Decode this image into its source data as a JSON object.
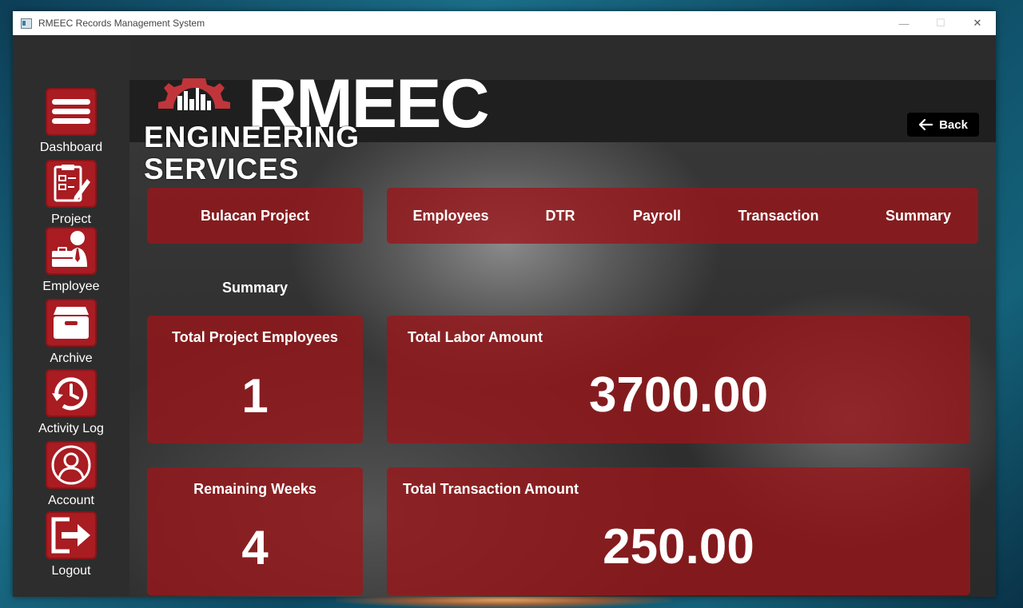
{
  "window": {
    "title": "RMEEC Records Management System",
    "controls": {
      "minimize": "—",
      "maximize": "☐",
      "close": "✕"
    }
  },
  "sidebar": {
    "items": [
      {
        "label": "Dashboard",
        "icon": "menu-icon"
      },
      {
        "label": "Project",
        "icon": "clipboard-edit-icon"
      },
      {
        "label": "Employee",
        "icon": "employee-briefcase-icon"
      },
      {
        "label": "Archive",
        "icon": "archive-box-icon"
      },
      {
        "label": "Activity Log",
        "icon": "history-clock-icon"
      },
      {
        "label": "Account",
        "icon": "user-circle-icon"
      },
      {
        "label": "Logout",
        "icon": "logout-icon"
      }
    ]
  },
  "header": {
    "logo_title": "RMEEC",
    "logo_subtitle": "ENGINEERING SERVICES",
    "back_label": "Back"
  },
  "project_tab": "Bulacan Project",
  "tabs": [
    "Employees",
    "DTR",
    "Payroll",
    "Transaction",
    "Summary"
  ],
  "section_title": "Summary",
  "cards": {
    "total_employees": {
      "label": "Total Project Employees",
      "value": "1"
    },
    "labor_amount": {
      "label": "Total Labor Amount",
      "value": "3700.00"
    },
    "remaining_weeks": {
      "label": "Remaining Weeks",
      "value": "4"
    },
    "transaction_amount": {
      "label": "Total Transaction Amount",
      "value": "250.00"
    }
  },
  "colors": {
    "accent": "#a81c22",
    "panel": "#9b161a",
    "sidebar": "#2d2d2d"
  }
}
